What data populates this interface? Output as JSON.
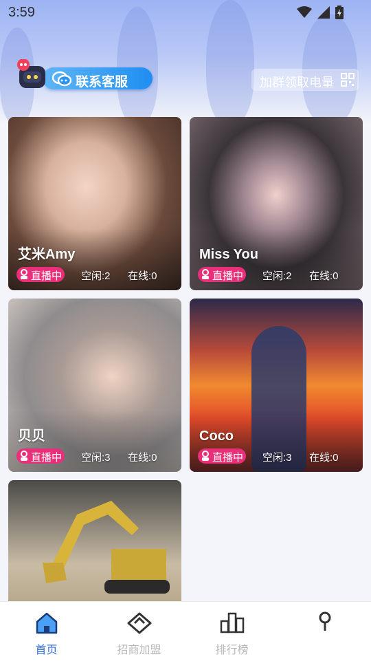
{
  "status_bar": {
    "time": "3:59"
  },
  "header": {
    "customer_service_label": "联系客服",
    "join_group_label": "加群领取电量"
  },
  "cards": [
    {
      "name": "艾米Amy",
      "live_label": "直播中",
      "idle": "空闲:2",
      "online": "在线:0"
    },
    {
      "name": "Miss You",
      "live_label": "直播中",
      "idle": "空闲:2",
      "online": "在线:0"
    },
    {
      "name": "贝贝",
      "live_label": "直播中",
      "idle": "空闲:3",
      "online": "在线:0"
    },
    {
      "name": "Coco",
      "live_label": "直播中",
      "idle": "空闲:3",
      "online": "在线:0"
    }
  ],
  "tabbar": {
    "tabs": [
      {
        "label": "首页",
        "icon": "home-icon",
        "active": true
      },
      {
        "label": "招商加盟",
        "icon": "handshake-icon",
        "active": false
      },
      {
        "label": "排行榜",
        "icon": "ranking-icon",
        "active": false
      },
      {
        "label": "",
        "icon": "profile-icon",
        "active": false
      }
    ]
  },
  "colors": {
    "accent": "#2f6fe0",
    "live_badge": "#e8307a",
    "service_button": "#1f8ef0"
  }
}
